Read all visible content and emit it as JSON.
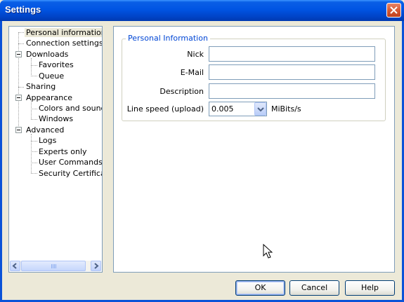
{
  "window": {
    "title": "Settings"
  },
  "tree": {
    "items": [
      {
        "label": "Personal information",
        "level": 0,
        "selected": true
      },
      {
        "label": "Connection settings",
        "level": 0
      },
      {
        "label": "Downloads",
        "level": 0,
        "expanded": true
      },
      {
        "label": "Favorites",
        "level": 1
      },
      {
        "label": "Queue",
        "level": 1
      },
      {
        "label": "Sharing",
        "level": 0
      },
      {
        "label": "Appearance",
        "level": 0,
        "expanded": true
      },
      {
        "label": "Colors and sounds",
        "level": 1
      },
      {
        "label": "Windows",
        "level": 1
      },
      {
        "label": "Advanced",
        "level": 0,
        "expanded": true
      },
      {
        "label": "Logs",
        "level": 1
      },
      {
        "label": "Experts only",
        "level": 1
      },
      {
        "label": "User Commands",
        "level": 1
      },
      {
        "label": "Security Certificates",
        "level": 1
      }
    ]
  },
  "personal": {
    "group_title": "Personal Information",
    "nick_label": "Nick",
    "nick_value": "",
    "email_label": "E-Mail",
    "email_value": "",
    "description_label": "Description",
    "description_value": "",
    "linespeed_label": "Line speed (upload)",
    "linespeed_value": "0.005",
    "linespeed_unit": "MiBits/s"
  },
  "buttons": {
    "ok": "OK",
    "cancel": "Cancel",
    "help": "Help"
  },
  "colors": {
    "titlebar": "#0054e3",
    "group_title": "#0046d5",
    "dialog_bg": "#ece9d8"
  }
}
